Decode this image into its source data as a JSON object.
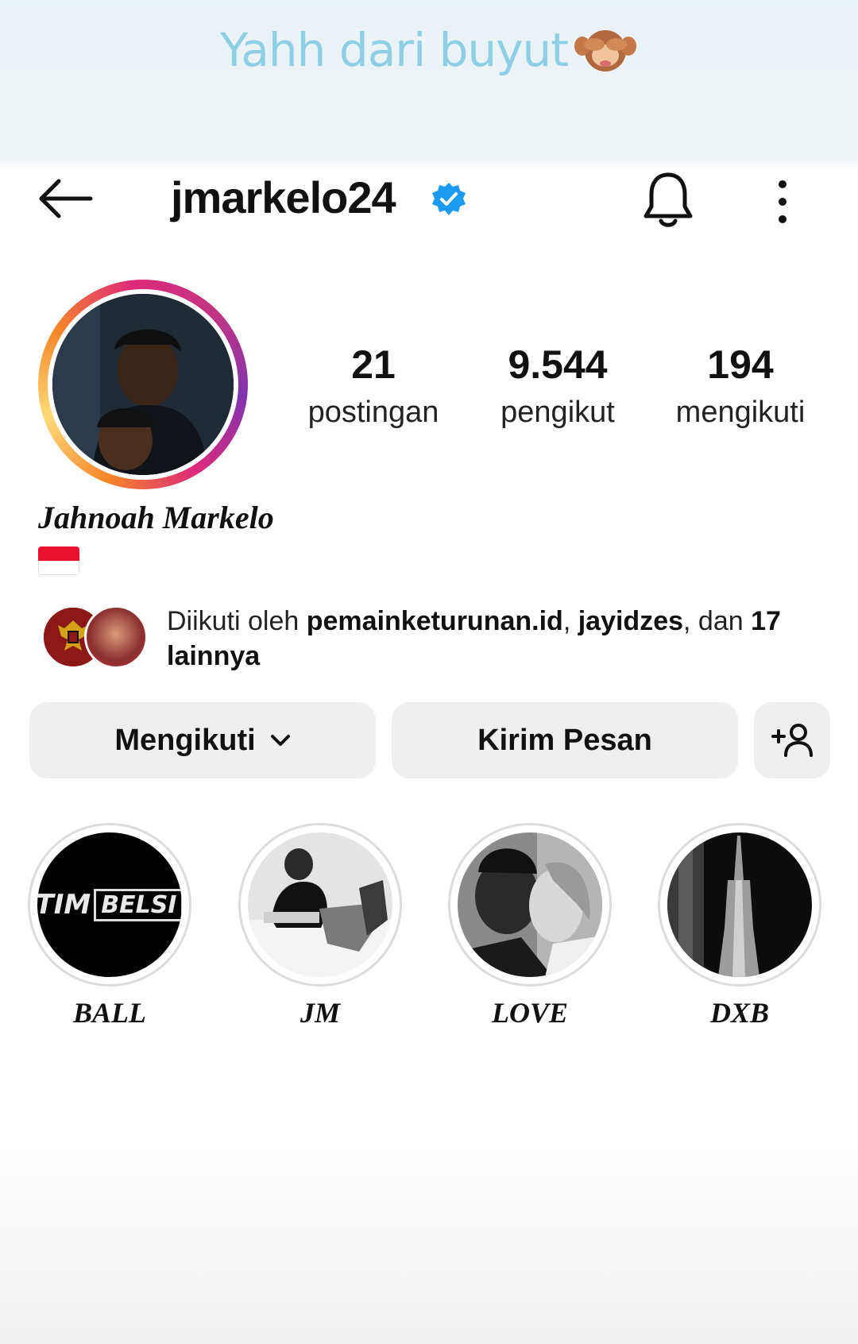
{
  "story_caption": "Yahh dari buyut",
  "caption_emoji": "see-no-evil-monkey-icon",
  "profile": {
    "username": "jmarkelo24",
    "verified": true,
    "full_name": "Jahnoah Markelo",
    "flag": "indonesia-flag-icon",
    "stats": {
      "posts_count": "21",
      "posts_label": "postingan",
      "followers_count": "9.544",
      "followers_label": "pengikut",
      "following_count": "194",
      "following_label": "mengikuti"
    },
    "followed_by": {
      "prefix": "Diikuti oleh ",
      "user1": "pemainketurunan.id",
      "separator": ", ",
      "user2": "jayidzes",
      "middle": ", dan ",
      "count": "17",
      "suffix": " lainnya"
    }
  },
  "buttons": {
    "follow_label": "Mengikuti",
    "message_label": "Kirim Pesan"
  },
  "highlights": [
    {
      "label": "BALL",
      "cover_text_a": "TIM",
      "cover_text_b": "BELSI"
    },
    {
      "label": "JM"
    },
    {
      "label": "LOVE"
    },
    {
      "label": "DXB"
    }
  ],
  "colors": {
    "caption": "#8ecfe6",
    "verified_badge": "#1d9bf0",
    "button_bg": "#efefef"
  }
}
